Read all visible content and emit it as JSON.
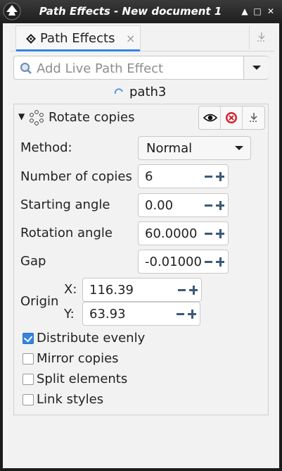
{
  "window": {
    "title": "Path Effects - New document 1"
  },
  "tab": {
    "label": "Path Effects",
    "close": "×"
  },
  "search": {
    "placeholder": "Add Live Path Effect"
  },
  "path": {
    "name": "path3"
  },
  "effect": {
    "title": "Rotate copies",
    "method_label": "Method:",
    "method_value": "Normal",
    "num_copies_label": "Number of copies",
    "num_copies_value": "6",
    "start_angle_label": "Starting angle",
    "start_angle_value": "0.00",
    "rotation_angle_label": "Rotation angle",
    "rotation_angle_value": "60.0000",
    "gap_label": "Gap",
    "gap_value": "-0.01000",
    "origin_label": "Origin",
    "origin_x_label": "X:",
    "origin_x_value": "116.39",
    "origin_y_label": "Y:",
    "origin_y_value": "63.93"
  },
  "options": [
    {
      "label": "Distribute evenly",
      "checked": true
    },
    {
      "label": "Mirror copies",
      "checked": false
    },
    {
      "label": "Split elements",
      "checked": false
    },
    {
      "label": "Link styles",
      "checked": false
    }
  ],
  "colors": {
    "accent": "#3584e4",
    "titlebar": "#2a2a2a",
    "spin_button": "#3b5a78",
    "delete_icon": "#d0202f"
  }
}
